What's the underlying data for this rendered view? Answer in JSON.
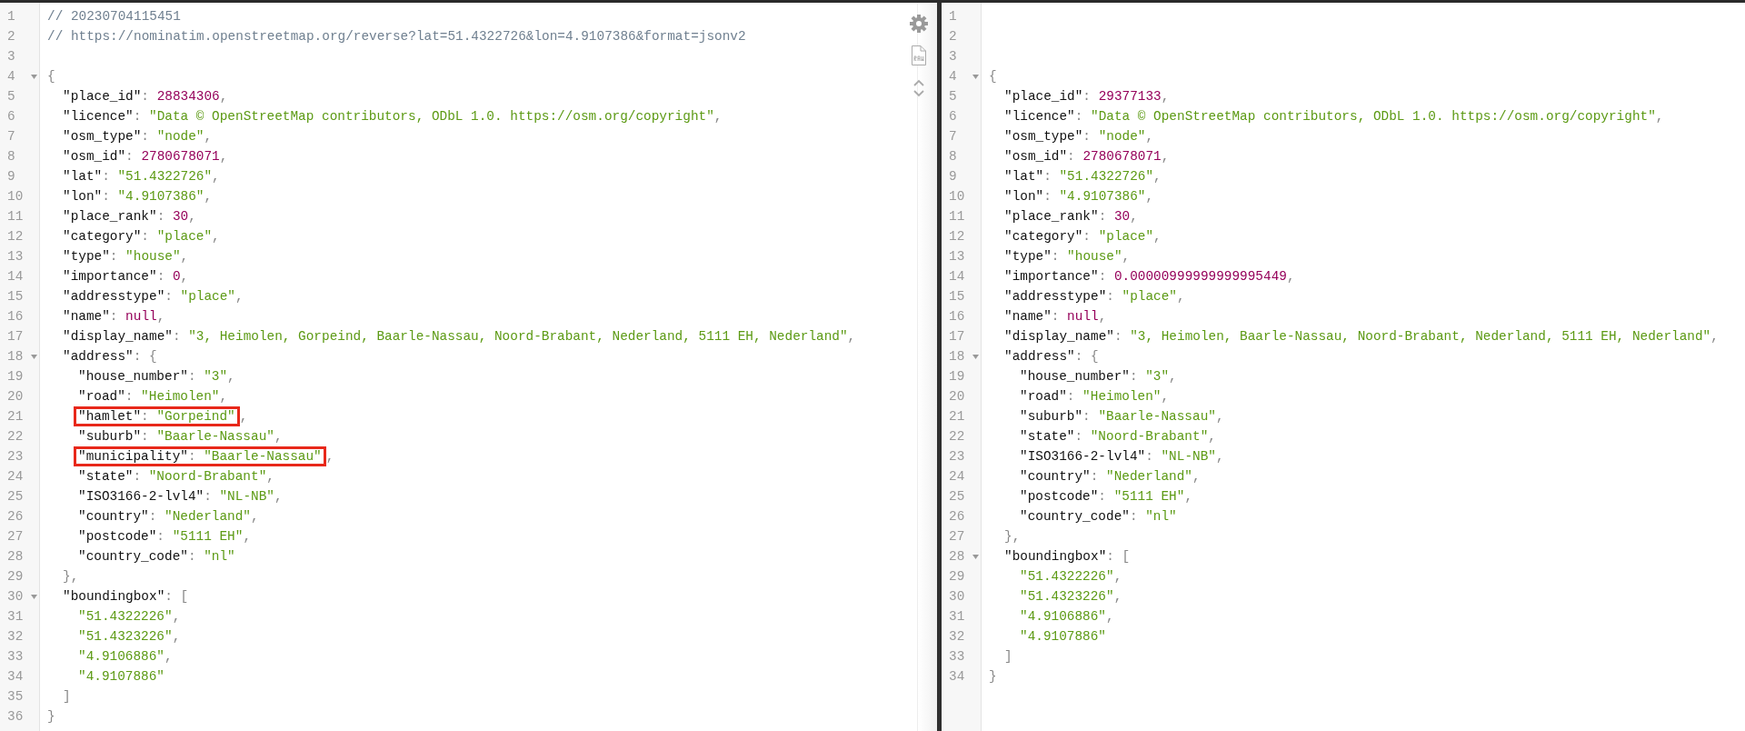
{
  "panes": [
    {
      "toolbar": true,
      "lines": [
        {
          "number": "1",
          "highlighted": false,
          "tokens": [
            {
              "kind": "comment",
              "text": "// 20230704115451"
            }
          ]
        },
        {
          "number": "2",
          "highlighted": false,
          "tokens": [
            {
              "kind": "comment",
              "text": "// https://nominatim.openstreetmap.org/reverse?lat=51.4322726&lon=4.9107386&format=jsonv2"
            }
          ]
        },
        {
          "number": "3"
        },
        {
          "number": "4",
          "highlighted": false,
          "expanded": true,
          "tokens": [
            {
              "kind": "punct",
              "text": "{"
            }
          ],
          "children": [
            {
              "number": "5",
              "highlighted": false,
              "tokens": [
                {
                  "kind": "key",
                  "text": "\"place_id\""
                },
                {
                  "kind": "punct",
                  "text": ": "
                },
                {
                  "kind": "number",
                  "text": "28834306"
                },
                {
                  "kind": "punct",
                  "text": ","
                }
              ]
            },
            {
              "number": "6",
              "highlighted": false,
              "tokens": [
                {
                  "kind": "key",
                  "text": "\"licence\""
                },
                {
                  "kind": "punct",
                  "text": ": "
                },
                {
                  "kind": "string",
                  "text": "\"Data © OpenStreetMap contributors, ODbL 1.0. https://osm.org/copyright\""
                },
                {
                  "kind": "punct",
                  "text": ","
                }
              ]
            },
            {
              "number": "7",
              "highlighted": false,
              "tokens": [
                {
                  "kind": "key",
                  "text": "\"osm_type\""
                },
                {
                  "kind": "punct",
                  "text": ": "
                },
                {
                  "kind": "string",
                  "text": "\"node\""
                },
                {
                  "kind": "punct",
                  "text": ","
                }
              ]
            },
            {
              "number": "8",
              "highlighted": false,
              "tokens": [
                {
                  "kind": "key",
                  "text": "\"osm_id\""
                },
                {
                  "kind": "punct",
                  "text": ": "
                },
                {
                  "kind": "number",
                  "text": "2780678071"
                },
                {
                  "kind": "punct",
                  "text": ","
                }
              ]
            },
            {
              "number": "9",
              "highlighted": false,
              "tokens": [
                {
                  "kind": "key",
                  "text": "\"lat\""
                },
                {
                  "kind": "punct",
                  "text": ": "
                },
                {
                  "kind": "string",
                  "text": "\"51.4322726\""
                },
                {
                  "kind": "punct",
                  "text": ","
                }
              ]
            },
            {
              "number": "10",
              "highlighted": false,
              "tokens": [
                {
                  "kind": "key",
                  "text": "\"lon\""
                },
                {
                  "kind": "punct",
                  "text": ": "
                },
                {
                  "kind": "string",
                  "text": "\"4.9107386\""
                },
                {
                  "kind": "punct",
                  "text": ","
                }
              ]
            },
            {
              "number": "11",
              "highlighted": false,
              "tokens": [
                {
                  "kind": "key",
                  "text": "\"place_rank\""
                },
                {
                  "kind": "punct",
                  "text": ": "
                },
                {
                  "kind": "number",
                  "text": "30"
                },
                {
                  "kind": "punct",
                  "text": ","
                }
              ]
            },
            {
              "number": "12",
              "highlighted": false,
              "tokens": [
                {
                  "kind": "key",
                  "text": "\"category\""
                },
                {
                  "kind": "punct",
                  "text": ": "
                },
                {
                  "kind": "string",
                  "text": "\"place\""
                },
                {
                  "kind": "punct",
                  "text": ","
                }
              ]
            },
            {
              "number": "13",
              "highlighted": false,
              "tokens": [
                {
                  "kind": "key",
                  "text": "\"type\""
                },
                {
                  "kind": "punct",
                  "text": ": "
                },
                {
                  "kind": "string",
                  "text": "\"house\""
                },
                {
                  "kind": "punct",
                  "text": ","
                }
              ]
            },
            {
              "number": "14",
              "highlighted": false,
              "tokens": [
                {
                  "kind": "key",
                  "text": "\"importance\""
                },
                {
                  "kind": "punct",
                  "text": ": "
                },
                {
                  "kind": "number",
                  "text": "0"
                },
                {
                  "kind": "punct",
                  "text": ","
                }
              ]
            },
            {
              "number": "15",
              "highlighted": false,
              "tokens": [
                {
                  "kind": "key",
                  "text": "\"addresstype\""
                },
                {
                  "kind": "punct",
                  "text": ": "
                },
                {
                  "kind": "string",
                  "text": "\"place\""
                },
                {
                  "kind": "punct",
                  "text": ","
                }
              ]
            },
            {
              "number": "16",
              "highlighted": false,
              "tokens": [
                {
                  "kind": "key",
                  "text": "\"name\""
                },
                {
                  "kind": "punct",
                  "text": ": "
                },
                {
                  "kind": "number",
                  "text": "null"
                },
                {
                  "kind": "punct",
                  "text": ","
                }
              ]
            },
            {
              "number": "17",
              "highlighted": false,
              "tokens": [
                {
                  "kind": "key",
                  "text": "\"display_name\""
                },
                {
                  "kind": "punct",
                  "text": ": "
                },
                {
                  "kind": "string",
                  "text": "\"3, Heimolen, Gorpeind, Baarle-Nassau, Noord-Brabant, Nederland, 5111 EH, Nederland\""
                },
                {
                  "kind": "punct",
                  "text": ","
                }
              ]
            },
            {
              "number": "18",
              "highlighted": false,
              "expanded": true,
              "tokens": [
                {
                  "kind": "key",
                  "text": "\"address\""
                },
                {
                  "kind": "punct",
                  "text": ": {"
                }
              ],
              "children": [
                {
                  "number": "19",
                  "highlighted": false,
                  "tokens": [
                    {
                      "kind": "key",
                      "text": "\"house_number\""
                    },
                    {
                      "kind": "punct",
                      "text": ": "
                    },
                    {
                      "kind": "string",
                      "text": "\"3\""
                    },
                    {
                      "kind": "punct",
                      "text": ","
                    }
                  ]
                },
                {
                  "number": "20",
                  "highlighted": false,
                  "tokens": [
                    {
                      "kind": "key",
                      "text": "\"road\""
                    },
                    {
                      "kind": "punct",
                      "text": ": "
                    },
                    {
                      "kind": "string",
                      "text": "\"Heimolen\""
                    },
                    {
                      "kind": "punct",
                      "text": ","
                    }
                  ]
                },
                {
                  "number": "21",
                  "highlighted": true,
                  "tokens": [
                    {
                      "kind": "key",
                      "text": "\"hamlet\""
                    },
                    {
                      "kind": "punct",
                      "text": ": "
                    },
                    {
                      "kind": "string",
                      "text": "\"Gorpeind\""
                    },
                    {
                      "kind": "punct",
                      "text": ","
                    }
                  ]
                },
                {
                  "number": "22",
                  "highlighted": false,
                  "tokens": [
                    {
                      "kind": "key",
                      "text": "\"suburb\""
                    },
                    {
                      "kind": "punct",
                      "text": ": "
                    },
                    {
                      "kind": "string",
                      "text": "\"Baarle-Nassau\""
                    },
                    {
                      "kind": "punct",
                      "text": ","
                    }
                  ]
                },
                {
                  "number": "23",
                  "highlighted": true,
                  "tokens": [
                    {
                      "kind": "key",
                      "text": "\"municipality\""
                    },
                    {
                      "kind": "punct",
                      "text": ": "
                    },
                    {
                      "kind": "string",
                      "text": "\"Baarle-Nassau\""
                    },
                    {
                      "kind": "punct",
                      "text": ","
                    }
                  ]
                },
                {
                  "number": "24",
                  "highlighted": false,
                  "tokens": [
                    {
                      "kind": "key",
                      "text": "\"state\""
                    },
                    {
                      "kind": "punct",
                      "text": ": "
                    },
                    {
                      "kind": "string",
                      "text": "\"Noord-Brabant\""
                    },
                    {
                      "kind": "punct",
                      "text": ","
                    }
                  ]
                },
                {
                  "number": "25",
                  "highlighted": false,
                  "tokens": [
                    {
                      "kind": "key",
                      "text": "\"ISO3166-2-lvl4\""
                    },
                    {
                      "kind": "punct",
                      "text": ": "
                    },
                    {
                      "kind": "string",
                      "text": "\"NL-NB\""
                    },
                    {
                      "kind": "punct",
                      "text": ","
                    }
                  ]
                },
                {
                  "number": "26",
                  "highlighted": false,
                  "tokens": [
                    {
                      "kind": "key",
                      "text": "\"country\""
                    },
                    {
                      "kind": "punct",
                      "text": ": "
                    },
                    {
                      "kind": "string",
                      "text": "\"Nederland\""
                    },
                    {
                      "kind": "punct",
                      "text": ","
                    }
                  ]
                },
                {
                  "number": "27",
                  "highlighted": false,
                  "tokens": [
                    {
                      "kind": "key",
                      "text": "\"postcode\""
                    },
                    {
                      "kind": "punct",
                      "text": ": "
                    },
                    {
                      "kind": "string",
                      "text": "\"5111 EH\""
                    },
                    {
                      "kind": "punct",
                      "text": ","
                    }
                  ]
                },
                {
                  "number": "28",
                  "highlighted": false,
                  "tokens": [
                    {
                      "kind": "key",
                      "text": "\"country_code\""
                    },
                    {
                      "kind": "punct",
                      "text": ": "
                    },
                    {
                      "kind": "string",
                      "text": "\"nl\""
                    }
                  ]
                }
              ]
            },
            {
              "number": "29",
              "highlighted": false,
              "tokens": [
                {
                  "kind": "punct",
                  "text": "},"
                }
              ]
            },
            {
              "number": "30",
              "highlighted": false,
              "expanded": true,
              "tokens": [
                {
                  "kind": "key",
                  "text": "\"boundingbox\""
                },
                {
                  "kind": "punct",
                  "text": ": ["
                }
              ],
              "children": [
                {
                  "number": "31",
                  "highlighted": false,
                  "tokens": [
                    {
                      "kind": "string",
                      "text": "\"51.4322226\""
                    },
                    {
                      "kind": "punct",
                      "text": ","
                    }
                  ]
                },
                {
                  "number": "32",
                  "highlighted": false,
                  "tokens": [
                    {
                      "kind": "string",
                      "text": "\"51.4323226\""
                    },
                    {
                      "kind": "punct",
                      "text": ","
                    }
                  ]
                },
                {
                  "number": "33",
                  "highlighted": false,
                  "tokens": [
                    {
                      "kind": "string",
                      "text": "\"4.9106886\""
                    },
                    {
                      "kind": "punct",
                      "text": ","
                    }
                  ]
                },
                {
                  "number": "34",
                  "highlighted": false,
                  "tokens": [
                    {
                      "kind": "string",
                      "text": "\"4.9107886\""
                    }
                  ]
                }
              ]
            },
            {
              "number": "35",
              "highlighted": false,
              "tokens": [
                {
                  "kind": "punct",
                  "text": "]"
                }
              ]
            }
          ]
        },
        {
          "number": "36",
          "highlighted": false,
          "tokens": [
            {
              "kind": "punct",
              "text": "}"
            }
          ]
        }
      ]
    },
    {
      "toolbar": false,
      "lines": [
        {
          "number": "1"
        },
        {
          "number": "2"
        },
        {
          "number": "3"
        },
        {
          "number": "4",
          "highlighted": false,
          "expanded": true,
          "tokens": [
            {
              "kind": "punct",
              "text": "{"
            }
          ],
          "children": [
            {
              "number": "5",
              "highlighted": false,
              "tokens": [
                {
                  "kind": "key",
                  "text": "\"place_id\""
                },
                {
                  "kind": "punct",
                  "text": ": "
                },
                {
                  "kind": "number",
                  "text": "29377133"
                },
                {
                  "kind": "punct",
                  "text": ","
                }
              ]
            },
            {
              "number": "6",
              "highlighted": false,
              "tokens": [
                {
                  "kind": "key",
                  "text": "\"licence\""
                },
                {
                  "kind": "punct",
                  "text": ": "
                },
                {
                  "kind": "string",
                  "text": "\"Data © OpenStreetMap contributors, ODbL 1.0. https://osm.org/copyright\""
                },
                {
                  "kind": "punct",
                  "text": ","
                }
              ]
            },
            {
              "number": "7",
              "highlighted": false,
              "tokens": [
                {
                  "kind": "key",
                  "text": "\"osm_type\""
                },
                {
                  "kind": "punct",
                  "text": ": "
                },
                {
                  "kind": "string",
                  "text": "\"node\""
                },
                {
                  "kind": "punct",
                  "text": ","
                }
              ]
            },
            {
              "number": "8",
              "highlighted": false,
              "tokens": [
                {
                  "kind": "key",
                  "text": "\"osm_id\""
                },
                {
                  "kind": "punct",
                  "text": ": "
                },
                {
                  "kind": "number",
                  "text": "2780678071"
                },
                {
                  "kind": "punct",
                  "text": ","
                }
              ]
            },
            {
              "number": "9",
              "highlighted": false,
              "tokens": [
                {
                  "kind": "key",
                  "text": "\"lat\""
                },
                {
                  "kind": "punct",
                  "text": ": "
                },
                {
                  "kind": "string",
                  "text": "\"51.4322726\""
                },
                {
                  "kind": "punct",
                  "text": ","
                }
              ]
            },
            {
              "number": "10",
              "highlighted": false,
              "tokens": [
                {
                  "kind": "key",
                  "text": "\"lon\""
                },
                {
                  "kind": "punct",
                  "text": ": "
                },
                {
                  "kind": "string",
                  "text": "\"4.9107386\""
                },
                {
                  "kind": "punct",
                  "text": ","
                }
              ]
            },
            {
              "number": "11",
              "highlighted": false,
              "tokens": [
                {
                  "kind": "key",
                  "text": "\"place_rank\""
                },
                {
                  "kind": "punct",
                  "text": ": "
                },
                {
                  "kind": "number",
                  "text": "30"
                },
                {
                  "kind": "punct",
                  "text": ","
                }
              ]
            },
            {
              "number": "12",
              "highlighted": false,
              "tokens": [
                {
                  "kind": "key",
                  "text": "\"category\""
                },
                {
                  "kind": "punct",
                  "text": ": "
                },
                {
                  "kind": "string",
                  "text": "\"place\""
                },
                {
                  "kind": "punct",
                  "text": ","
                }
              ]
            },
            {
              "number": "13",
              "highlighted": false,
              "tokens": [
                {
                  "kind": "key",
                  "text": "\"type\""
                },
                {
                  "kind": "punct",
                  "text": ": "
                },
                {
                  "kind": "string",
                  "text": "\"house\""
                },
                {
                  "kind": "punct",
                  "text": ","
                }
              ]
            },
            {
              "number": "14",
              "highlighted": false,
              "tokens": [
                {
                  "kind": "key",
                  "text": "\"importance\""
                },
                {
                  "kind": "punct",
                  "text": ": "
                },
                {
                  "kind": "number",
                  "text": "0.00000999999999995449"
                },
                {
                  "kind": "punct",
                  "text": ","
                }
              ]
            },
            {
              "number": "15",
              "highlighted": false,
              "tokens": [
                {
                  "kind": "key",
                  "text": "\"addresstype\""
                },
                {
                  "kind": "punct",
                  "text": ": "
                },
                {
                  "kind": "string",
                  "text": "\"place\""
                },
                {
                  "kind": "punct",
                  "text": ","
                }
              ]
            },
            {
              "number": "16",
              "highlighted": false,
              "tokens": [
                {
                  "kind": "key",
                  "text": "\"name\""
                },
                {
                  "kind": "punct",
                  "text": ": "
                },
                {
                  "kind": "number",
                  "text": "null"
                },
                {
                  "kind": "punct",
                  "text": ","
                }
              ]
            },
            {
              "number": "17",
              "highlighted": false,
              "tokens": [
                {
                  "kind": "key",
                  "text": "\"display_name\""
                },
                {
                  "kind": "punct",
                  "text": ": "
                },
                {
                  "kind": "string",
                  "text": "\"3, Heimolen, Baarle-Nassau, Noord-Brabant, Nederland, 5111 EH, Nederland\""
                },
                {
                  "kind": "punct",
                  "text": ","
                }
              ]
            },
            {
              "number": "18",
              "highlighted": false,
              "expanded": true,
              "tokens": [
                {
                  "kind": "key",
                  "text": "\"address\""
                },
                {
                  "kind": "punct",
                  "text": ": {"
                }
              ],
              "children": [
                {
                  "number": "19",
                  "highlighted": false,
                  "tokens": [
                    {
                      "kind": "key",
                      "text": "\"house_number\""
                    },
                    {
                      "kind": "punct",
                      "text": ": "
                    },
                    {
                      "kind": "string",
                      "text": "\"3\""
                    },
                    {
                      "kind": "punct",
                      "text": ","
                    }
                  ]
                },
                {
                  "number": "20",
                  "highlighted": false,
                  "tokens": [
                    {
                      "kind": "key",
                      "text": "\"road\""
                    },
                    {
                      "kind": "punct",
                      "text": ": "
                    },
                    {
                      "kind": "string",
                      "text": "\"Heimolen\""
                    },
                    {
                      "kind": "punct",
                      "text": ","
                    }
                  ]
                },
                {
                  "number": "21",
                  "highlighted": false,
                  "tokens": [
                    {
                      "kind": "key",
                      "text": "\"suburb\""
                    },
                    {
                      "kind": "punct",
                      "text": ": "
                    },
                    {
                      "kind": "string",
                      "text": "\"Baarle-Nassau\""
                    },
                    {
                      "kind": "punct",
                      "text": ","
                    }
                  ]
                },
                {
                  "number": "22",
                  "highlighted": false,
                  "tokens": [
                    {
                      "kind": "key",
                      "text": "\"state\""
                    },
                    {
                      "kind": "punct",
                      "text": ": "
                    },
                    {
                      "kind": "string",
                      "text": "\"Noord-Brabant\""
                    },
                    {
                      "kind": "punct",
                      "text": ","
                    }
                  ]
                },
                {
                  "number": "23",
                  "highlighted": false,
                  "tokens": [
                    {
                      "kind": "key",
                      "text": "\"ISO3166-2-lvl4\""
                    },
                    {
                      "kind": "punct",
                      "text": ": "
                    },
                    {
                      "kind": "string",
                      "text": "\"NL-NB\""
                    },
                    {
                      "kind": "punct",
                      "text": ","
                    }
                  ]
                },
                {
                  "number": "24",
                  "highlighted": false,
                  "tokens": [
                    {
                      "kind": "key",
                      "text": "\"country\""
                    },
                    {
                      "kind": "punct",
                      "text": ": "
                    },
                    {
                      "kind": "string",
                      "text": "\"Nederland\""
                    },
                    {
                      "kind": "punct",
                      "text": ","
                    }
                  ]
                },
                {
                  "number": "25",
                  "highlighted": false,
                  "tokens": [
                    {
                      "kind": "key",
                      "text": "\"postcode\""
                    },
                    {
                      "kind": "punct",
                      "text": ": "
                    },
                    {
                      "kind": "string",
                      "text": "\"5111 EH\""
                    },
                    {
                      "kind": "punct",
                      "text": ","
                    }
                  ]
                },
                {
                  "number": "26",
                  "highlighted": false,
                  "tokens": [
                    {
                      "kind": "key",
                      "text": "\"country_code\""
                    },
                    {
                      "kind": "punct",
                      "text": ": "
                    },
                    {
                      "kind": "string",
                      "text": "\"nl\""
                    }
                  ]
                }
              ]
            },
            {
              "number": "27",
              "highlighted": false,
              "tokens": [
                {
                  "kind": "punct",
                  "text": "},"
                }
              ]
            },
            {
              "number": "28",
              "highlighted": false,
              "expanded": true,
              "tokens": [
                {
                  "kind": "key",
                  "text": "\"boundingbox\""
                },
                {
                  "kind": "punct",
                  "text": ": ["
                }
              ],
              "children": [
                {
                  "number": "29",
                  "highlighted": false,
                  "tokens": [
                    {
                      "kind": "string",
                      "text": "\"51.4322226\""
                    },
                    {
                      "kind": "punct",
                      "text": ","
                    }
                  ]
                },
                {
                  "number": "30",
                  "highlighted": false,
                  "tokens": [
                    {
                      "kind": "string",
                      "text": "\"51.4323226\""
                    },
                    {
                      "kind": "punct",
                      "text": ","
                    }
                  ]
                },
                {
                  "number": "31",
                  "highlighted": false,
                  "tokens": [
                    {
                      "kind": "string",
                      "text": "\"4.9106886\""
                    },
                    {
                      "kind": "punct",
                      "text": ","
                    }
                  ]
                },
                {
                  "number": "32",
                  "highlighted": false,
                  "tokens": [
                    {
                      "kind": "string",
                      "text": "\"4.9107886\""
                    }
                  ]
                }
              ]
            },
            {
              "number": "33",
              "highlighted": false,
              "tokens": [
                {
                  "kind": "punct",
                  "text": "]"
                }
              ]
            }
          ]
        },
        {
          "number": "34",
          "highlighted": false,
          "tokens": [
            {
              "kind": "punct",
              "text": "}"
            }
          ]
        }
      ]
    }
  ]
}
